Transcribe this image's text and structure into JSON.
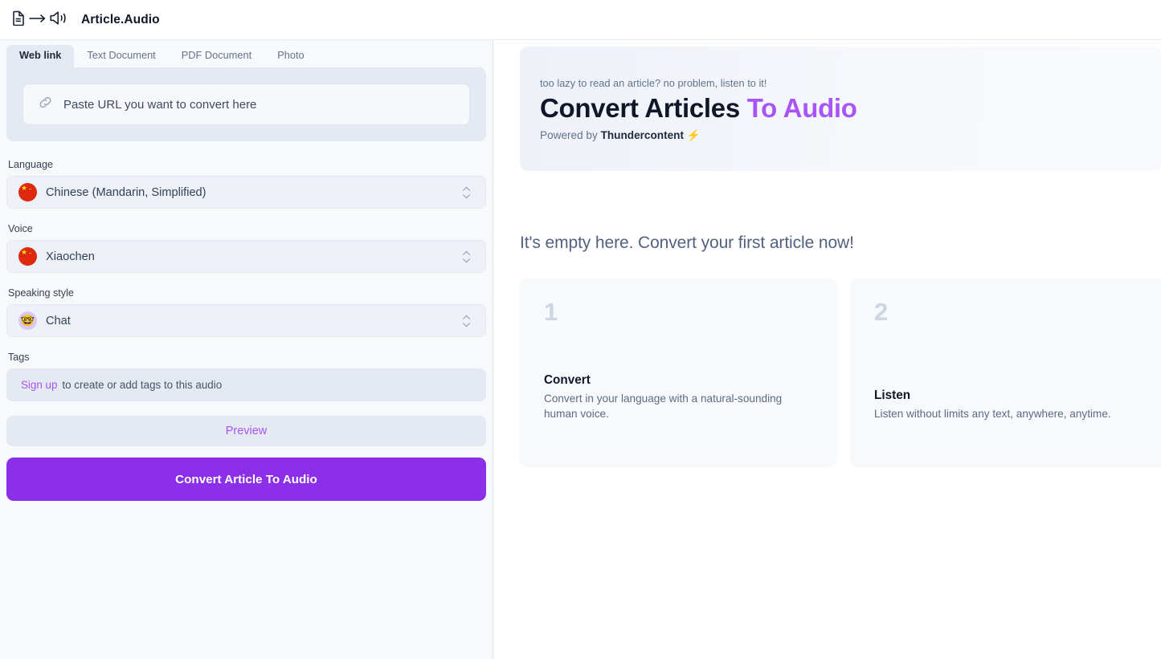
{
  "app": {
    "title": "Article.Audio",
    "icons": [
      "document-icon",
      "arrow-right-icon",
      "speaker-icon"
    ]
  },
  "tabs": [
    {
      "label": "Web link",
      "active": true
    },
    {
      "label": "Text Document",
      "active": false
    },
    {
      "label": "PDF Document",
      "active": false
    },
    {
      "label": "Photo",
      "active": false
    }
  ],
  "url_input": {
    "placeholder": "Paste URL you want to convert here",
    "value": "",
    "icon": "link-icon"
  },
  "fields": {
    "language": {
      "label": "Language",
      "value": "Chinese (Mandarin, Simplified)",
      "badge": "flag-china-icon"
    },
    "voice": {
      "label": "Voice",
      "value": "Xiaochen",
      "badge": "flag-china-icon"
    },
    "speaking_style": {
      "label": "Speaking style",
      "value": "Chat",
      "badge": "nerd-face-emoji",
      "emoji": "🤓"
    },
    "tags": {
      "label": "Tags",
      "link_label": "Sign up",
      "hint": "to create or add tags to this audio"
    }
  },
  "actions": {
    "preview_label": "Preview",
    "convert_label": "Convert Article To Audio"
  },
  "hero": {
    "kicker": "too lazy to read an article? no problem, listen to it!",
    "headline_main": "Convert Articles ",
    "headline_accent": "To Audio",
    "powered_prefix": "Powered by ",
    "powered_brand": "Thundercontent",
    "powered_bolt": "⚡"
  },
  "empty_state": {
    "title": "It's empty here. Convert your first article now!"
  },
  "steps": [
    {
      "number": "1",
      "title": "Convert",
      "desc": "Convert in your language with a natural-sounding human voice."
    },
    {
      "number": "2",
      "title": "Listen",
      "desc": "Listen without limits any text, anywhere, anytime."
    }
  ],
  "colors": {
    "brand_purple": "#8b2fe8",
    "accent_purple": "#a855f7",
    "panel_bg": "#f8f9fb",
    "field_bg": "#e4e9f2",
    "text_dark": "#0f1729",
    "text_muted": "#64748b",
    "bolt_yellow": "#f5b30b"
  }
}
